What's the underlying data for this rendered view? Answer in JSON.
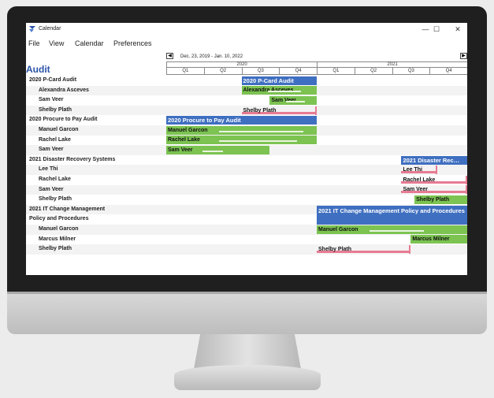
{
  "window": {
    "title": "Calendar",
    "minimize_glyph": "—",
    "maximize_glyph": "☐",
    "close_glyph": "✕"
  },
  "menu": [
    "File",
    "View",
    "Calendar",
    "Preferences"
  ],
  "nav": {
    "prev": "◀",
    "next": "▶",
    "date_range": "Dec. 23, 2019 - Jan. 10, 2022"
  },
  "section_title": "Audit",
  "timeline": {
    "years": [
      "2020",
      "2021"
    ],
    "quarters": [
      "Q1",
      "Q2",
      "Q3",
      "Q4",
      "Q1",
      "Q2",
      "Q3",
      "Q4"
    ]
  },
  "rows": [
    {
      "label": "2020 P-Card Audit",
      "type": "group"
    },
    {
      "label": "Alexandra Asceves",
      "type": "member"
    },
    {
      "label": "Sam Veer",
      "type": "member"
    },
    {
      "label": "Shelby Plath",
      "type": "member"
    },
    {
      "label": "2020 Procure to Pay Audit",
      "type": "group"
    },
    {
      "label": "Manuel Garcon",
      "type": "member"
    },
    {
      "label": "Rachel Lake",
      "type": "member"
    },
    {
      "label": "Sam Veer",
      "type": "member"
    },
    {
      "label": "2021 Disaster Recovery Systems",
      "type": "group"
    },
    {
      "label": "Lee Thi",
      "type": "member"
    },
    {
      "label": "Rachel Lake",
      "type": "member"
    },
    {
      "label": "Sam Veer",
      "type": "member"
    },
    {
      "label": "Shelby Plath",
      "type": "member"
    },
    {
      "label": "2021 IT Change Management",
      "type": "group"
    },
    {
      "label": "Policy and Procedures",
      "type": "group"
    },
    {
      "label": "Manuel Garcon",
      "type": "member"
    },
    {
      "label": "Marcus Milner",
      "type": "member"
    },
    {
      "label": "Shelby Plath",
      "type": "member"
    }
  ],
  "bars": [
    {
      "row": 0,
      "label": "2020 P-Card Audit",
      "color": "blue",
      "start_q": 2.0,
      "end_q": 4.0
    },
    {
      "row": 1,
      "label": "Alexandra Asceves",
      "color": "green",
      "start_q": 2.0,
      "end_q": 4.0,
      "progress": 0.55
    },
    {
      "row": 2,
      "label": "Sam Veer",
      "color": "green",
      "start_q": 2.75,
      "end_q": 4.0,
      "progress": 0.5
    },
    {
      "row": 3,
      "label": "Shelby Plath",
      "color": "pink",
      "start_q": 2.0,
      "end_q": 4.0
    },
    {
      "row": 4,
      "label": "2020 Procure to Pay Audit",
      "color": "blue",
      "start_q": 0.0,
      "end_q": 4.0
    },
    {
      "row": 5,
      "label": "Manuel Garcon",
      "color": "green",
      "start_q": 0.0,
      "end_q": 4.0,
      "progress": 0.7
    },
    {
      "row": 6,
      "label": "Rachel Lake",
      "color": "green",
      "start_q": 0.0,
      "end_q": 4.0,
      "progress": 0.65
    },
    {
      "row": 7,
      "label": "Sam Veer",
      "color": "green",
      "start_q": 0.0,
      "end_q": 2.75,
      "progress": 0.25
    },
    {
      "row": 8,
      "label": "2021 Disaster Recovery Systems",
      "color": "blue",
      "label_short": "2021 Disaster Rec…",
      "start_q": 6.25,
      "end_q": 8.0
    },
    {
      "row": 9,
      "label": "Lee Thi",
      "color": "pink",
      "start_q": 6.25,
      "end_q": 7.2
    },
    {
      "row": 10,
      "label": "Rachel Lake",
      "color": "pink",
      "start_q": 6.25,
      "end_q": 8.0
    },
    {
      "row": 11,
      "label": "Sam Veer",
      "color": "pink",
      "start_q": 6.25,
      "end_q": 8.0
    },
    {
      "row": 12,
      "label": "Shelby Plath",
      "color": "green",
      "start_q": 6.6,
      "end_q": 8.0,
      "progress": 0
    },
    {
      "row": 13,
      "label": "2021 IT Change Management Policy and Procedures",
      "color": "blue",
      "start_q": 4.0,
      "end_q": 8.0,
      "two_line": true
    },
    {
      "row": 15,
      "label": "Manuel Garcon",
      "color": "green",
      "start_q": 4.0,
      "end_q": 8.0,
      "progress": 0.45
    },
    {
      "row": 16,
      "label": "Marcus Milner",
      "color": "green",
      "start_q": 6.5,
      "end_q": 8.0,
      "progress": 0
    },
    {
      "row": 17,
      "label": "Shelby Plath",
      "color": "pink",
      "start_q": 4.0,
      "end_q": 6.5
    }
  ]
}
